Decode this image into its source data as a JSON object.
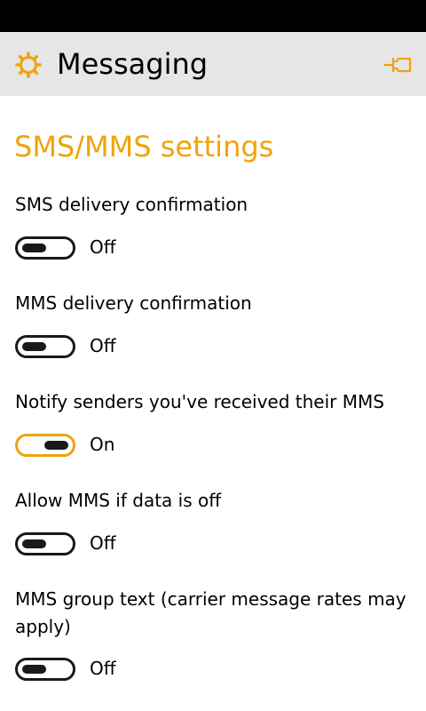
{
  "app": {
    "title": "Messaging",
    "accent_color": "#f0a30a",
    "header_background": "#e6e6e6",
    "header_icon": "gear-icon",
    "pin_icon": "pin-icon"
  },
  "section_title": "SMS/MMS settings",
  "settings": [
    {
      "label": "SMS delivery confirmation",
      "state_label": "Off",
      "on": false
    },
    {
      "label": "MMS delivery confirmation",
      "state_label": "Off",
      "on": false
    },
    {
      "label": "Notify senders you've received their MMS",
      "state_label": "On",
      "on": true
    },
    {
      "label": "Allow MMS if data is off",
      "state_label": "Off",
      "on": false
    },
    {
      "label": "MMS group text (carrier message rates may apply)",
      "state_label": "Off",
      "on": false
    }
  ]
}
